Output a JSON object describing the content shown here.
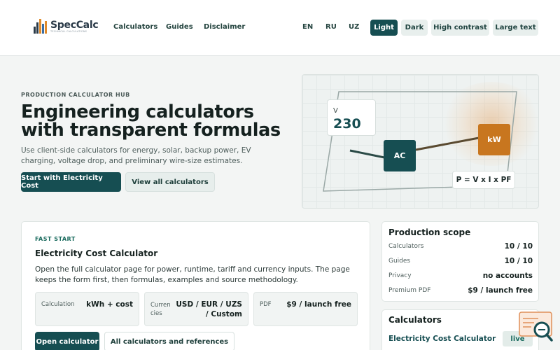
{
  "brand": {
    "name": "SpecCalc",
    "tagline": "TECHNICAL CALCULATIONS"
  },
  "nav": [
    "Calculators",
    "Guides",
    "Disclaimer"
  ],
  "languages": [
    "EN",
    "RU",
    "UZ"
  ],
  "themes": [
    {
      "label": "Light",
      "active": true
    },
    {
      "label": "Dark",
      "active": false
    },
    {
      "label": "High contrast",
      "active": false
    },
    {
      "label": "Large text",
      "active": false
    }
  ],
  "hero": {
    "eyebrow": "PRODUCTION CALCULATOR HUB",
    "title_line1": "Engineering calculators",
    "title_line2": "with transparent formulas",
    "description": "Use client-side calculators for energy, solar, backup power, EV charging, voltage drop, and preliminary wire-size estimates.",
    "primary_button": "Start with Electricity Cost",
    "secondary_button": "View all calculators"
  },
  "diagram": {
    "voltage_label": "V",
    "voltage_value": "230",
    "ac_label": "AC",
    "kw_label": "kW",
    "formula": "P = V x I x PF",
    "colors": {
      "ac": "#164e52",
      "kw": "#c8761f"
    }
  },
  "fast_start": {
    "eyebrow": "FAST START",
    "title": "Electricity Cost Calculator",
    "description": "Open the full calculator page for power, runtime, tariff and currency inputs. The page keeps the form first, then formulas, examples and source methodology.",
    "info": [
      {
        "label": "Calculation",
        "value": "kWh + cost"
      },
      {
        "label_line1": "Curren",
        "label_line2": "cies",
        "value_line1": "USD / EUR / UZS",
        "value_line2": "/ Custom"
      },
      {
        "label": "PDF",
        "value": "$9 / launch free"
      }
    ],
    "open_button": "Open calculator",
    "all_button": "All calculators and references"
  },
  "scope": {
    "title": "Production scope",
    "rows": [
      {
        "key": "Calculators",
        "value": "10 / 10"
      },
      {
        "key": "Guides",
        "value": "10 / 10"
      },
      {
        "key": "Privacy",
        "value": "no accounts"
      },
      {
        "key": "Premium PDF",
        "value": "$9 / launch free"
      }
    ]
  },
  "calculators": {
    "title": "Calculators",
    "item": "Electricity Cost Calculator",
    "badge": "live"
  },
  "colors": {
    "accent": "#164e52",
    "orange": "#c8761f",
    "green_text": "#1a6b5e"
  }
}
